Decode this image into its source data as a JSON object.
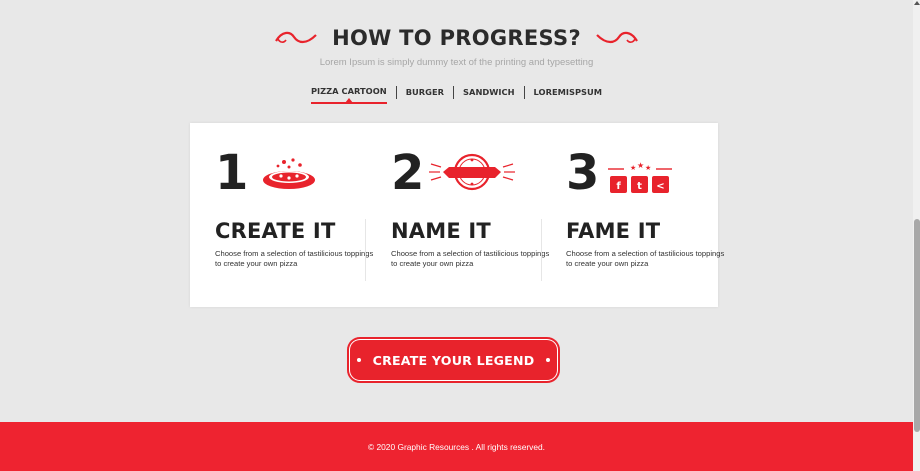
{
  "heading": {
    "title": "HOW TO PROGRESS?",
    "subtitle": "Lorem Ipsum is simply dummy text of the printing and typesetting"
  },
  "tabs": [
    {
      "label": "PIZZA CARTOON",
      "active": true
    },
    {
      "label": "BURGER",
      "active": false
    },
    {
      "label": "SANDWICH",
      "active": false
    },
    {
      "label": "LOREMISPSUM",
      "active": false
    }
  ],
  "steps": [
    {
      "number": "1",
      "title": "CREATE IT",
      "description": "Choose from a selection of tastilicious toppings to create your own pizza",
      "icon": "pizza-icon"
    },
    {
      "number": "2",
      "title": "NAME IT",
      "description": "Choose from a selection of tastilicious toppings to create your own pizza",
      "icon": "badge-ribbon-icon"
    },
    {
      "number": "3",
      "title": "FAME IT",
      "description": "Choose from a selection of tastilicious toppings to create your own pizza",
      "icon": "social-share-icon"
    }
  ],
  "social_glyphs": {
    "facebook": "f",
    "twitter": "t",
    "share": "<"
  },
  "cta": {
    "label": "CREATE YOUR LEGEND"
  },
  "footer": {
    "text": "© 2020 Graphic Resources . All rights reserved."
  },
  "colors": {
    "accent": "#e8232c",
    "footer_bg": "#ee2330",
    "page_bg": "#e8e8e8",
    "text_dark": "#222222"
  }
}
